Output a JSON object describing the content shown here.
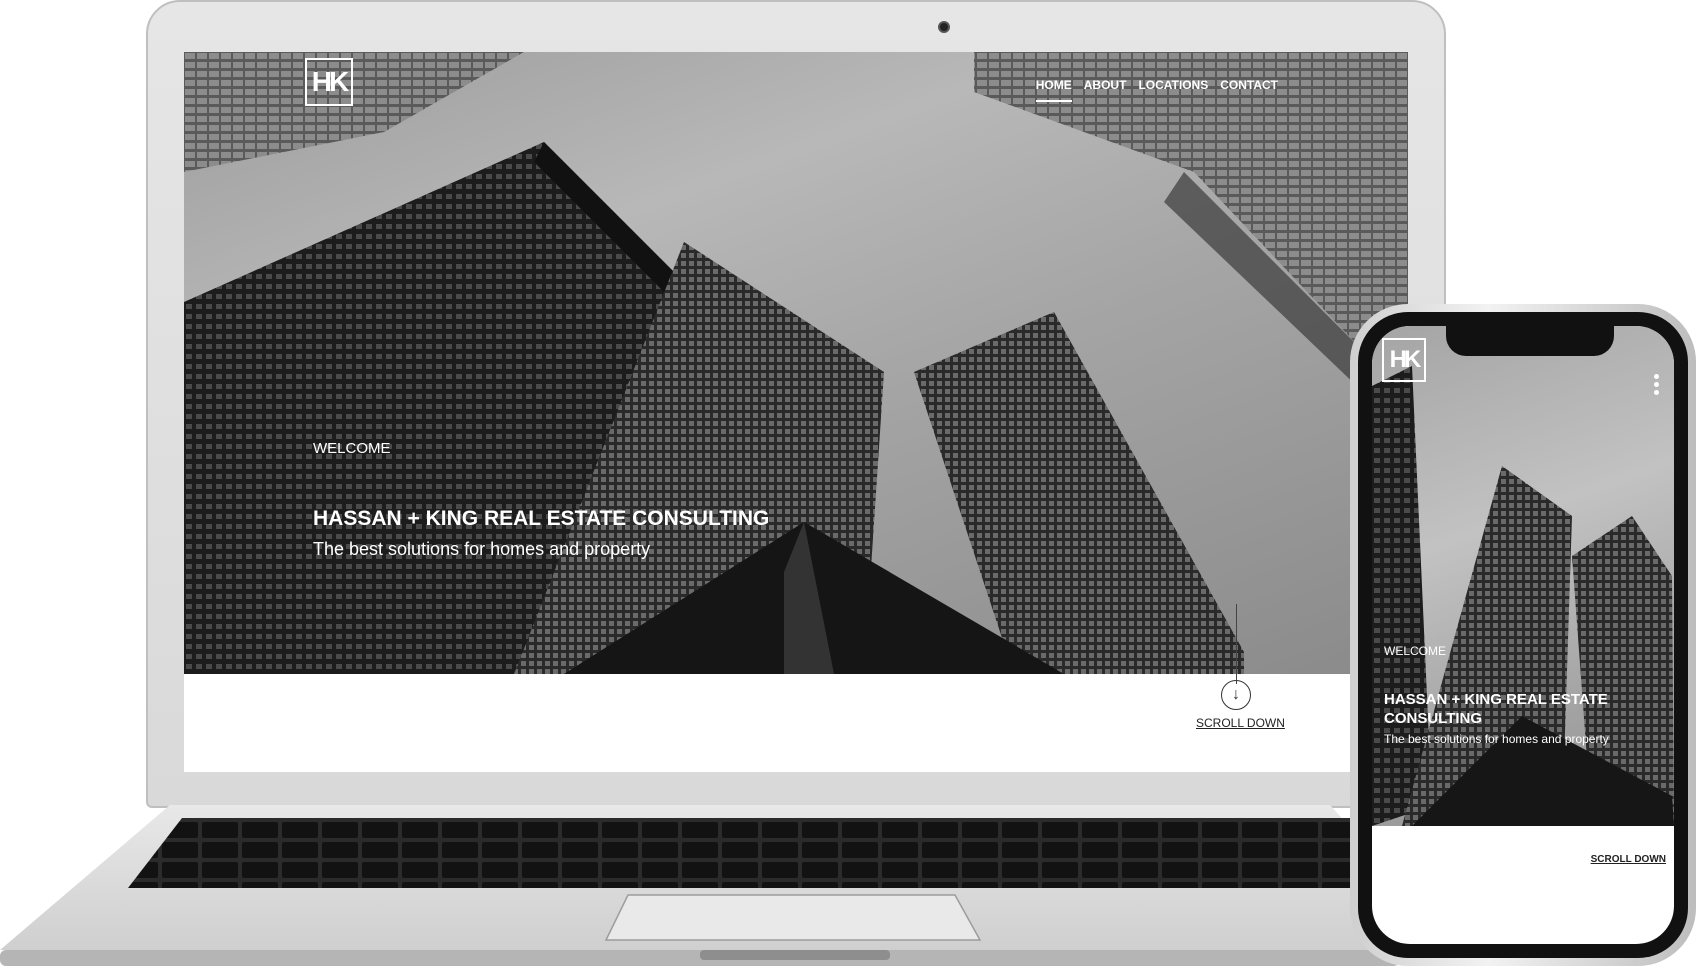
{
  "brand": {
    "logo_text": "HK"
  },
  "nav": {
    "items": [
      "HOME",
      "ABOUT",
      "LOCATIONS",
      "CONTACT"
    ],
    "active": "HOME"
  },
  "hero": {
    "eyebrow": "WELCOME",
    "title": "HASSAN + KING REAL ESTATE CONSULTING",
    "subtitle": "The best solutions for homes and property"
  },
  "scroll": {
    "label": "SCROLL DOWN",
    "icon": "arrow-down-icon"
  },
  "mobile": {
    "logo_text": "HK",
    "eyebrow": "WELCOME",
    "title": "HASSAN + KING REAL ESTATE CONSULTING",
    "subtitle": "The best solutions for homes and property",
    "scroll_label": "SCROLL DOWN",
    "menu_icon": "kebab-menu-icon"
  },
  "colors": {
    "hero_text": "#ffffff",
    "frame": "#d9d9d9",
    "keys": "#1a1a1a"
  }
}
